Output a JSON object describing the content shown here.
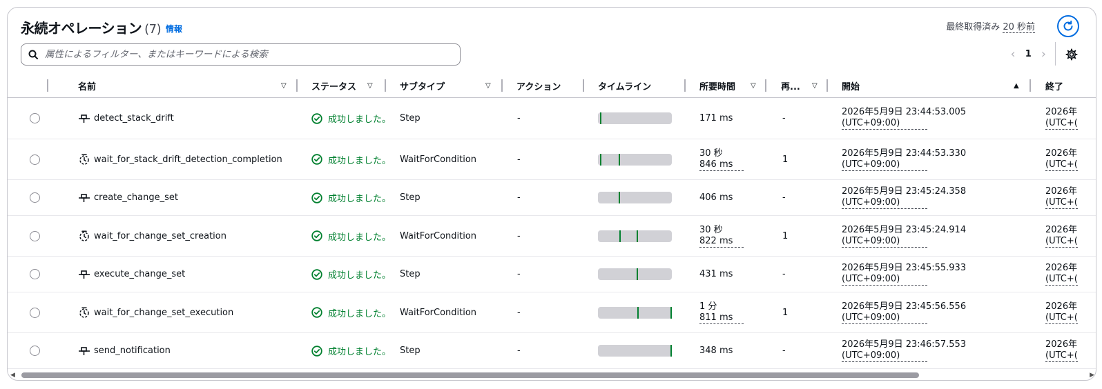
{
  "header": {
    "title": "永続オペレーション",
    "count": "(7)",
    "info": "情報",
    "last_fetched_label": "最終取得済み",
    "last_fetched_value": "20 秒前"
  },
  "search": {
    "placeholder": "属性によるフィルター、またはキーワードによる検索"
  },
  "pagination": {
    "current": "1"
  },
  "columns": {
    "name": "名前",
    "status": "ステータス",
    "subtype": "サブタイプ",
    "action": "アクション",
    "timeline": "タイムライン",
    "duration": "所要時間",
    "retries": "再...",
    "start": "開始",
    "end": "終了"
  },
  "rows": [
    {
      "name": "detect_stack_drift",
      "icon": "step-icon",
      "status": "成功しました。",
      "subtype": "Step",
      "action": "-",
      "duration_1": "171 ms",
      "duration_2": "",
      "retries": "-",
      "start_1": "2026年5月9日 23:44:53.005",
      "start_2": "(UTC+09:00)",
      "end_1": "2026年",
      "end_2": "(UTC+(",
      "timeline": [
        0.03
      ]
    },
    {
      "name": "wait_for_stack_drift_detection_completion",
      "icon": "wait-icon",
      "status": "成功しました。",
      "subtype": "WaitForCondition",
      "action": "-",
      "duration_1": "30 秒",
      "duration_2": "846 ms",
      "retries": "1",
      "start_1": "2026年5月9日 23:44:53.330",
      "start_2": "(UTC+09:00)",
      "end_1": "2026年",
      "end_2": "(UTC+(",
      "timeline": [
        0.03,
        0.28
      ]
    },
    {
      "name": "create_change_set",
      "icon": "step-icon",
      "status": "成功しました。",
      "subtype": "Step",
      "action": "-",
      "duration_1": "406 ms",
      "duration_2": "",
      "retries": "-",
      "start_1": "2026年5月9日 23:45:24.358",
      "start_2": "(UTC+09:00)",
      "end_1": "2026年",
      "end_2": "(UTC+(",
      "timeline": [
        0.28
      ]
    },
    {
      "name": "wait_for_change_set_creation",
      "icon": "wait-icon",
      "status": "成功しました。",
      "subtype": "WaitForCondition",
      "action": "-",
      "duration_1": "30 秒",
      "duration_2": "822 ms",
      "retries": "1",
      "start_1": "2026年5月9日 23:45:24.914",
      "start_2": "(UTC+09:00)",
      "end_1": "2026年",
      "end_2": "(UTC+(",
      "timeline": [
        0.29,
        0.52
      ]
    },
    {
      "name": "execute_change_set",
      "icon": "step-icon",
      "status": "成功しました。",
      "subtype": "Step",
      "action": "-",
      "duration_1": "431 ms",
      "duration_2": "",
      "retries": "-",
      "start_1": "2026年5月9日 23:45:55.933",
      "start_2": "(UTC+09:00)",
      "end_1": "2026年",
      "end_2": "(UTC+(",
      "timeline": [
        0.52
      ]
    },
    {
      "name": "wait_for_change_set_execution",
      "icon": "wait-icon",
      "status": "成功しました。",
      "subtype": "WaitForCondition",
      "action": "-",
      "duration_1": "1 分",
      "duration_2": "811 ms",
      "retries": "1",
      "start_1": "2026年5月9日 23:45:56.556",
      "start_2": "(UTC+09:00)",
      "end_1": "2026年",
      "end_2": "(UTC+(",
      "timeline": [
        0.53,
        0.99
      ]
    },
    {
      "name": "send_notification",
      "icon": "step-icon",
      "status": "成功しました。",
      "subtype": "Step",
      "action": "-",
      "duration_1": "348 ms",
      "duration_2": "",
      "retries": "-",
      "start_1": "2026年5月9日 23:46:57.553",
      "start_2": "(UTC+09:00)",
      "end_1": "2026年",
      "end_2": "(UTC+(",
      "timeline": [
        0.99
      ]
    }
  ],
  "colors": {
    "accent": "#006ce0",
    "success": "#00802f",
    "timeline_bg": "#d1d1d6"
  }
}
